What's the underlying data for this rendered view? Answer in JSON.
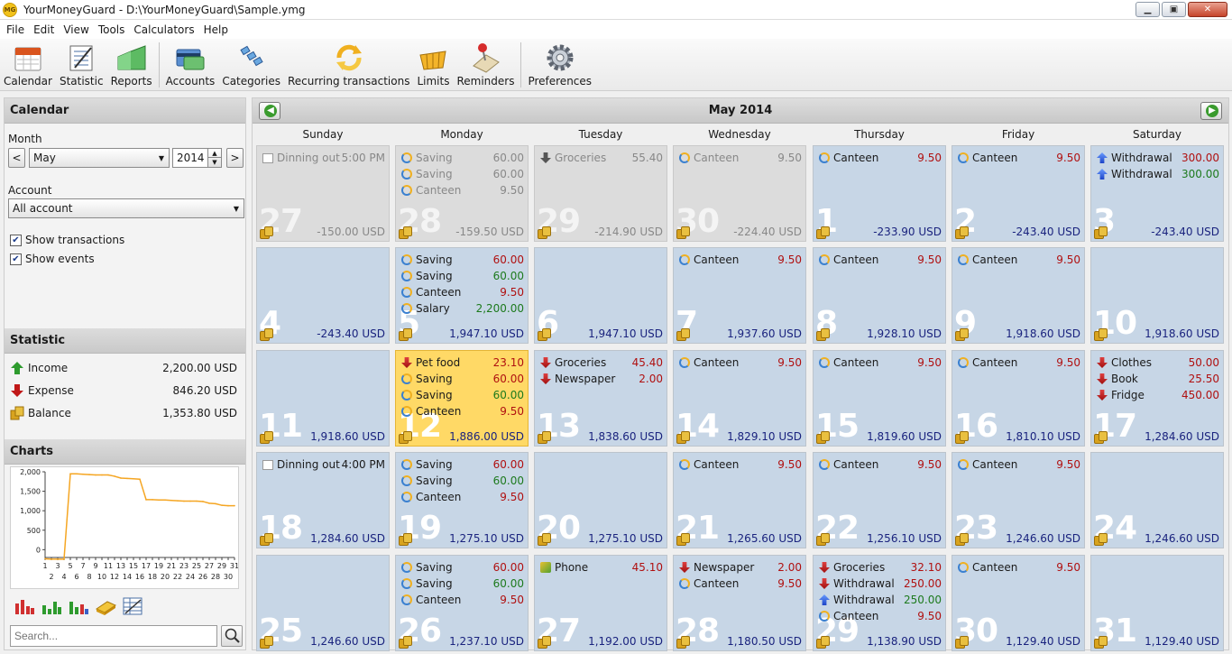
{
  "window": {
    "icon_text": "MG",
    "title": "YourMoneyGuard - D:\\YourMoneyGuard\\Sample.ymg",
    "minimize": "▁",
    "maximize": "▣",
    "close": "✕"
  },
  "menu": [
    "File",
    "Edit",
    "View",
    "Tools",
    "Calculators",
    "Help"
  ],
  "toolbar": [
    {
      "label": "Calendar",
      "icon": "calendar-icon"
    },
    {
      "label": "Statistic",
      "icon": "statistic-icon"
    },
    {
      "label": "Reports",
      "icon": "reports-icon"
    },
    {
      "label": "Accounts",
      "icon": "accounts-icon"
    },
    {
      "label": "Categories",
      "icon": "categories-icon"
    },
    {
      "label": "Recurring transactions",
      "icon": "recurring-icon"
    },
    {
      "label": "Limits",
      "icon": "limits-icon"
    },
    {
      "label": "Reminders",
      "icon": "reminders-icon"
    },
    {
      "label": "Preferences",
      "icon": "preferences-icon"
    }
  ],
  "sidebar": {
    "calendar_title": "Calendar",
    "month_label": "Month",
    "prev": "<",
    "next": ">",
    "month_value": "May",
    "year_value": "2014",
    "account_label": "Account",
    "account_value": "All account",
    "show_transactions": "Show transactions",
    "show_events": "Show events",
    "statistic_title": "Statistic",
    "stats": [
      {
        "name": "Income",
        "value": "2,200.00 USD",
        "icon": "income-up-arrow-icon",
        "color": "#2e9b2e"
      },
      {
        "name": "Expense",
        "value": "846.20 USD",
        "icon": "expense-down-arrow-icon",
        "color": "#c01818"
      },
      {
        "name": "Balance",
        "value": "1,353.80 USD",
        "icon": "balance-coins-icon",
        "color": "#d8a31e"
      }
    ],
    "charts_title": "Charts",
    "search_placeholder": "Search..."
  },
  "chart_data": {
    "type": "line",
    "yticks": [
      "2,000",
      "1,500",
      "1,000",
      "500",
      "0"
    ],
    "ylim": [
      -200,
      2000
    ],
    "xticks_top": [
      "1",
      "3",
      "5",
      "7",
      "9",
      "11",
      "13",
      "15",
      "17",
      "19",
      "21",
      "23",
      "25",
      "27",
      "29",
      "31"
    ],
    "xticks_bottom": [
      "2",
      "4",
      "6",
      "8",
      "10",
      "12",
      "14",
      "16",
      "18",
      "20",
      "22",
      "24",
      "26",
      "28",
      "30"
    ],
    "x": [
      1,
      2,
      3,
      4,
      5,
      6,
      7,
      8,
      9,
      10,
      11,
      12,
      13,
      14,
      15,
      16,
      17,
      18,
      19,
      20,
      21,
      22,
      23,
      24,
      25,
      26,
      27,
      28,
      29,
      30,
      31
    ],
    "y": [
      -233.9,
      -243.4,
      -243.4,
      -243.4,
      1947.1,
      1947.1,
      1937.6,
      1928.1,
      1918.6,
      1918.6,
      1918.6,
      1886.0,
      1838.6,
      1829.1,
      1819.6,
      1810.1,
      1284.6,
      1284.6,
      1275.1,
      1275.1,
      1265.6,
      1256.1,
      1246.6,
      1246.6,
      1246.6,
      1237.1,
      1192.0,
      1180.5,
      1138.9,
      1129.4,
      1129.4
    ],
    "color": "#f5a623"
  },
  "calendar": {
    "title": "May 2014",
    "days": [
      "Sunday",
      "Monday",
      "Tuesday",
      "Wednesday",
      "Thursday",
      "Friday",
      "Saturday"
    ],
    "weeks": [
      [
        {
          "day": "27",
          "other": true,
          "balance": "-150.00 USD",
          "items": [
            {
              "icon": "event",
              "name": "Dinning out",
              "value": "5:00 PM",
              "cls": ""
            }
          ]
        },
        {
          "day": "28",
          "other": true,
          "balance": "-159.50 USD",
          "items": [
            {
              "icon": "recur",
              "name": "Saving",
              "value": "60.00",
              "cls": ""
            },
            {
              "icon": "recur",
              "name": "Saving",
              "value": "60.00",
              "cls": ""
            },
            {
              "icon": "recur",
              "name": "Canteen",
              "value": "9.50",
              "cls": ""
            }
          ]
        },
        {
          "day": "29",
          "other": true,
          "balance": "-214.90 USD",
          "items": [
            {
              "icon": "gdown",
              "name": "Groceries",
              "value": "55.40",
              "cls": ""
            }
          ]
        },
        {
          "day": "30",
          "other": true,
          "balance": "-224.40 USD",
          "items": [
            {
              "icon": "recur",
              "name": "Canteen",
              "value": "9.50",
              "cls": ""
            }
          ]
        },
        {
          "day": "1",
          "balance": "-233.90 USD",
          "items": [
            {
              "icon": "recur",
              "name": "Canteen",
              "value": "9.50",
              "cls": "neg"
            }
          ]
        },
        {
          "day": "2",
          "balance": "-243.40 USD",
          "items": [
            {
              "icon": "recur",
              "name": "Canteen",
              "value": "9.50",
              "cls": "neg"
            }
          ]
        },
        {
          "day": "3",
          "balance": "-243.40 USD",
          "items": [
            {
              "icon": "up",
              "name": "Withdrawal",
              "value": "300.00",
              "cls": "neg"
            },
            {
              "icon": "up",
              "name": "Withdrawal",
              "value": "300.00",
              "cls": "pos"
            }
          ]
        }
      ],
      [
        {
          "day": "4",
          "balance": "-243.40 USD",
          "items": []
        },
        {
          "day": "5",
          "balance": "1,947.10 USD",
          "items": [
            {
              "icon": "recur",
              "name": "Saving",
              "value": "60.00",
              "cls": "neg"
            },
            {
              "icon": "recur",
              "name": "Saving",
              "value": "60.00",
              "cls": "pos"
            },
            {
              "icon": "recur",
              "name": "Canteen",
              "value": "9.50",
              "cls": "neg"
            },
            {
              "icon": "recur",
              "name": "Salary",
              "value": "2,200.00",
              "cls": "pos"
            }
          ]
        },
        {
          "day": "6",
          "balance": "1,947.10 USD",
          "items": []
        },
        {
          "day": "7",
          "balance": "1,937.60 USD",
          "items": [
            {
              "icon": "recur",
              "name": "Canteen",
              "value": "9.50",
              "cls": "neg"
            }
          ]
        },
        {
          "day": "8",
          "balance": "1,928.10 USD",
          "items": [
            {
              "icon": "recur",
              "name": "Canteen",
              "value": "9.50",
              "cls": "neg"
            }
          ]
        },
        {
          "day": "9",
          "balance": "1,918.60 USD",
          "items": [
            {
              "icon": "recur",
              "name": "Canteen",
              "value": "9.50",
              "cls": "neg"
            }
          ]
        },
        {
          "day": "10",
          "balance": "1,918.60 USD",
          "items": []
        }
      ],
      [
        {
          "day": "11",
          "balance": "1,918.60 USD",
          "items": []
        },
        {
          "day": "12",
          "today": true,
          "balance": "1,886.00 USD",
          "items": [
            {
              "icon": "down",
              "name": "Pet food",
              "value": "23.10",
              "cls": "neg"
            },
            {
              "icon": "recur",
              "name": "Saving",
              "value": "60.00",
              "cls": "neg"
            },
            {
              "icon": "recur",
              "name": "Saving",
              "value": "60.00",
              "cls": "pos"
            },
            {
              "icon": "recur",
              "name": "Canteen",
              "value": "9.50",
              "cls": "neg"
            }
          ]
        },
        {
          "day": "13",
          "balance": "1,838.60 USD",
          "items": [
            {
              "icon": "down",
              "name": "Groceries",
              "value": "45.40",
              "cls": "neg"
            },
            {
              "icon": "down",
              "name": "Newspaper",
              "value": "2.00",
              "cls": "neg"
            }
          ]
        },
        {
          "day": "14",
          "balance": "1,829.10 USD",
          "items": [
            {
              "icon": "recur",
              "name": "Canteen",
              "value": "9.50",
              "cls": "neg"
            }
          ]
        },
        {
          "day": "15",
          "balance": "1,819.60 USD",
          "items": [
            {
              "icon": "recur",
              "name": "Canteen",
              "value": "9.50",
              "cls": "neg"
            }
          ]
        },
        {
          "day": "16",
          "balance": "1,810.10 USD",
          "items": [
            {
              "icon": "recur",
              "name": "Canteen",
              "value": "9.50",
              "cls": "neg"
            }
          ]
        },
        {
          "day": "17",
          "balance": "1,284.60 USD",
          "items": [
            {
              "icon": "down",
              "name": "Clothes",
              "value": "50.00",
              "cls": "neg"
            },
            {
              "icon": "down",
              "name": "Book",
              "value": "25.50",
              "cls": "neg"
            },
            {
              "icon": "down",
              "name": "Fridge",
              "value": "450.00",
              "cls": "neg"
            }
          ]
        }
      ],
      [
        {
          "day": "18",
          "balance": "1,284.60 USD",
          "items": [
            {
              "icon": "event",
              "name": "Dinning out",
              "value": "4:00 PM",
              "cls": ""
            }
          ]
        },
        {
          "day": "19",
          "balance": "1,275.10 USD",
          "items": [
            {
              "icon": "recur",
              "name": "Saving",
              "value": "60.00",
              "cls": "neg"
            },
            {
              "icon": "recur",
              "name": "Saving",
              "value": "60.00",
              "cls": "pos"
            },
            {
              "icon": "recur",
              "name": "Canteen",
              "value": "9.50",
              "cls": "neg"
            }
          ]
        },
        {
          "day": "20",
          "balance": "1,275.10 USD",
          "items": []
        },
        {
          "day": "21",
          "balance": "1,265.60 USD",
          "items": [
            {
              "icon": "recur",
              "name": "Canteen",
              "value": "9.50",
              "cls": "neg"
            }
          ]
        },
        {
          "day": "22",
          "balance": "1,256.10 USD",
          "items": [
            {
              "icon": "recur",
              "name": "Canteen",
              "value": "9.50",
              "cls": "neg"
            }
          ]
        },
        {
          "day": "23",
          "balance": "1,246.60 USD",
          "items": [
            {
              "icon": "recur",
              "name": "Canteen",
              "value": "9.50",
              "cls": "neg"
            }
          ]
        },
        {
          "day": "24",
          "balance": "1,246.60 USD",
          "items": []
        }
      ],
      [
        {
          "day": "25",
          "balance": "1,246.60 USD",
          "items": []
        },
        {
          "day": "26",
          "balance": "1,237.10 USD",
          "items": [
            {
              "icon": "recur",
              "name": "Saving",
              "value": "60.00",
              "cls": "neg"
            },
            {
              "icon": "recur",
              "name": "Saving",
              "value": "60.00",
              "cls": "pos"
            },
            {
              "icon": "recur",
              "name": "Canteen",
              "value": "9.50",
              "cls": "neg"
            }
          ]
        },
        {
          "day": "27",
          "balance": "1,192.00 USD",
          "items": [
            {
              "icon": "phone",
              "name": "Phone",
              "value": "45.10",
              "cls": "neg"
            }
          ]
        },
        {
          "day": "28",
          "balance": "1,180.50 USD",
          "items": [
            {
              "icon": "down",
              "name": "Newspaper",
              "value": "2.00",
              "cls": "neg"
            },
            {
              "icon": "recur",
              "name": "Canteen",
              "value": "9.50",
              "cls": "neg"
            }
          ]
        },
        {
          "day": "29",
          "balance": "1,138.90 USD",
          "items": [
            {
              "icon": "down",
              "name": "Groceries",
              "value": "32.10",
              "cls": "neg"
            },
            {
              "icon": "down",
              "name": "Withdrawal",
              "value": "250.00",
              "cls": "neg"
            },
            {
              "icon": "up",
              "name": "Withdrawal",
              "value": "250.00",
              "cls": "pos"
            },
            {
              "icon": "recur",
              "name": "Canteen",
              "value": "9.50",
              "cls": "neg"
            }
          ]
        },
        {
          "day": "30",
          "balance": "1,129.40 USD",
          "items": [
            {
              "icon": "recur",
              "name": "Canteen",
              "value": "9.50",
              "cls": "neg"
            }
          ]
        },
        {
          "day": "31",
          "balance": "1,129.40 USD",
          "items": []
        }
      ]
    ]
  }
}
